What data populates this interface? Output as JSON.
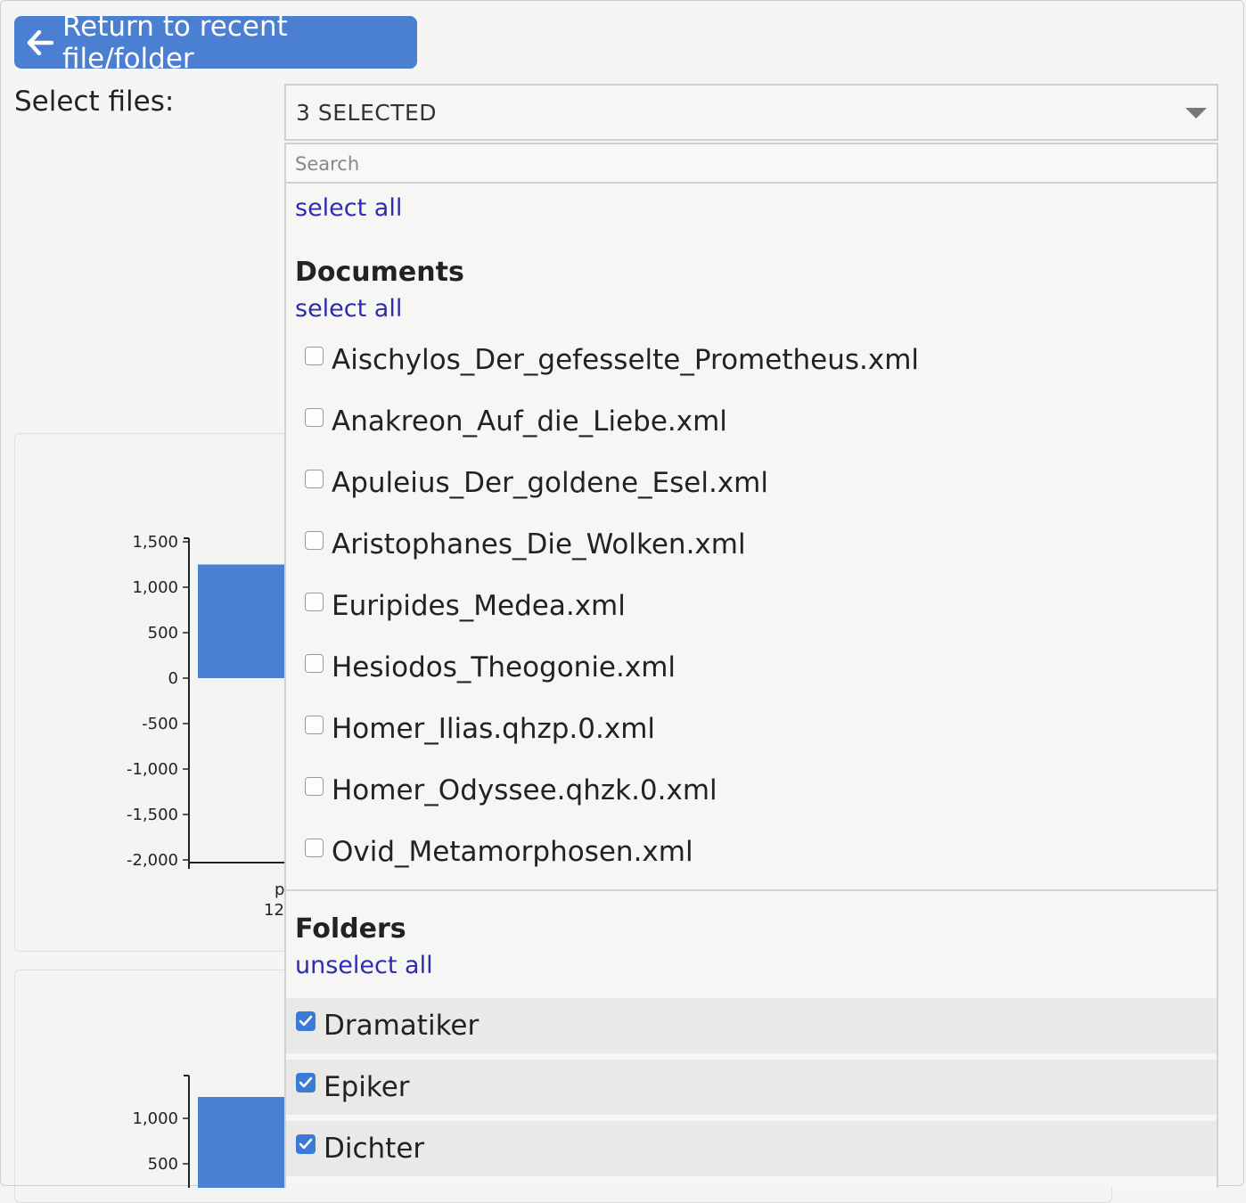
{
  "back_button": {
    "label": "Return to recent file/folder",
    "icon": "arrow-left-icon"
  },
  "select_files_label": "Select files:",
  "dropdown": {
    "selected_text": "3 SELECTED",
    "search_placeholder": "Search",
    "select_all_label": "select all",
    "groups": {
      "documents": {
        "title": "Documents",
        "action_label": "select all",
        "items": [
          {
            "label": "Aischylos_Der_gefesselte_Prometheus.xml",
            "checked": false
          },
          {
            "label": "Anakreon_Auf_die_Liebe.xml",
            "checked": false
          },
          {
            "label": "Apuleius_Der_goldene_Esel.xml",
            "checked": false
          },
          {
            "label": "Aristophanes_Die_Wolken.xml",
            "checked": false
          },
          {
            "label": "Euripides_Medea.xml",
            "checked": false
          },
          {
            "label": "Hesiodos_Theogonie.xml",
            "checked": false
          },
          {
            "label": "Homer_Ilias.qhzp.0.xml",
            "checked": false
          },
          {
            "label": "Homer_Odyssee.qhzk.0.xml",
            "checked": false
          },
          {
            "label": "Ovid_Metamorphosen.xml",
            "checked": false
          }
        ]
      },
      "folders": {
        "title": "Folders",
        "action_label": "unselect all",
        "items": [
          {
            "label": "Dramatiker",
            "checked": true
          },
          {
            "label": "Epiker",
            "checked": true
          },
          {
            "label": "Dichter",
            "checked": true
          }
        ]
      }
    }
  },
  "background_charts": {
    "chart1": {
      "y_ticks": [
        "1,500",
        "1,000",
        "500",
        "0",
        "-500",
        "-1,000",
        "-1,500",
        "-2,000"
      ],
      "x_label_fragment": "p",
      "x_value_fragment": "12",
      "bar_value": 1250
    },
    "chart2": {
      "y_ticks": [
        "1,000",
        "500"
      ]
    }
  },
  "colors": {
    "accent": "#4a7fd1",
    "link": "#2c2cb0",
    "bar": "#4a7fd1",
    "checkbox": "#3b7ad6"
  }
}
